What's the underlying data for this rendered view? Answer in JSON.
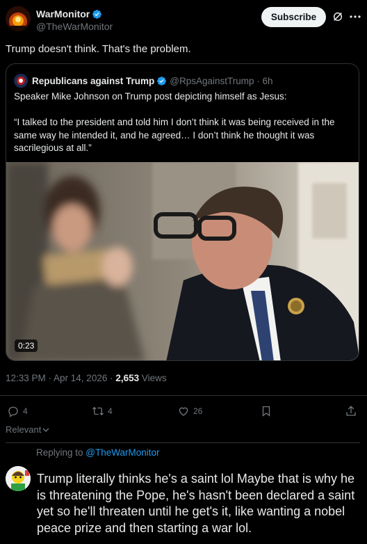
{
  "post": {
    "author_name": "WarMonitor",
    "author_handle": "@TheWarMonitor",
    "subscribe_label": "Subscribe",
    "text": "Trump doesn't think. That's the problem.",
    "timestamp": "12:33 PM · Apr 14, 2026 · ",
    "views_count": "2,653",
    "views_label": " Views"
  },
  "quote": {
    "author_name": "Republicans against Trump",
    "author_handle": "@RpsAgainstTrump · 6h",
    "text": "Speaker Mike Johnson on Trump post depicting himself as Jesus:\n\n“I talked to the president and told him I don’t think it was being received in the same way he intended it, and he agreed… I don’t think he thought it was sacrilegious at all.”",
    "video_duration": "0:23"
  },
  "actions": {
    "replies": "4",
    "reposts": "4",
    "likes": "26"
  },
  "sort": {
    "label": "Relevant"
  },
  "reply": {
    "replying_prefix": "Replying to ",
    "replying_to": "@TheWarMonitor",
    "text": "Trump literally thinks he's a saint lol Maybe that is why he is threatening the Pope, he's hasn't been declared a saint yet so he'll threaten until he get's it, like wanting a nobel peace prize and then starting a war lol."
  },
  "colors": {
    "accent": "#1d9bf0",
    "verified": "#1d9bf0",
    "muted": "#71767b",
    "border": "#2f3336"
  }
}
